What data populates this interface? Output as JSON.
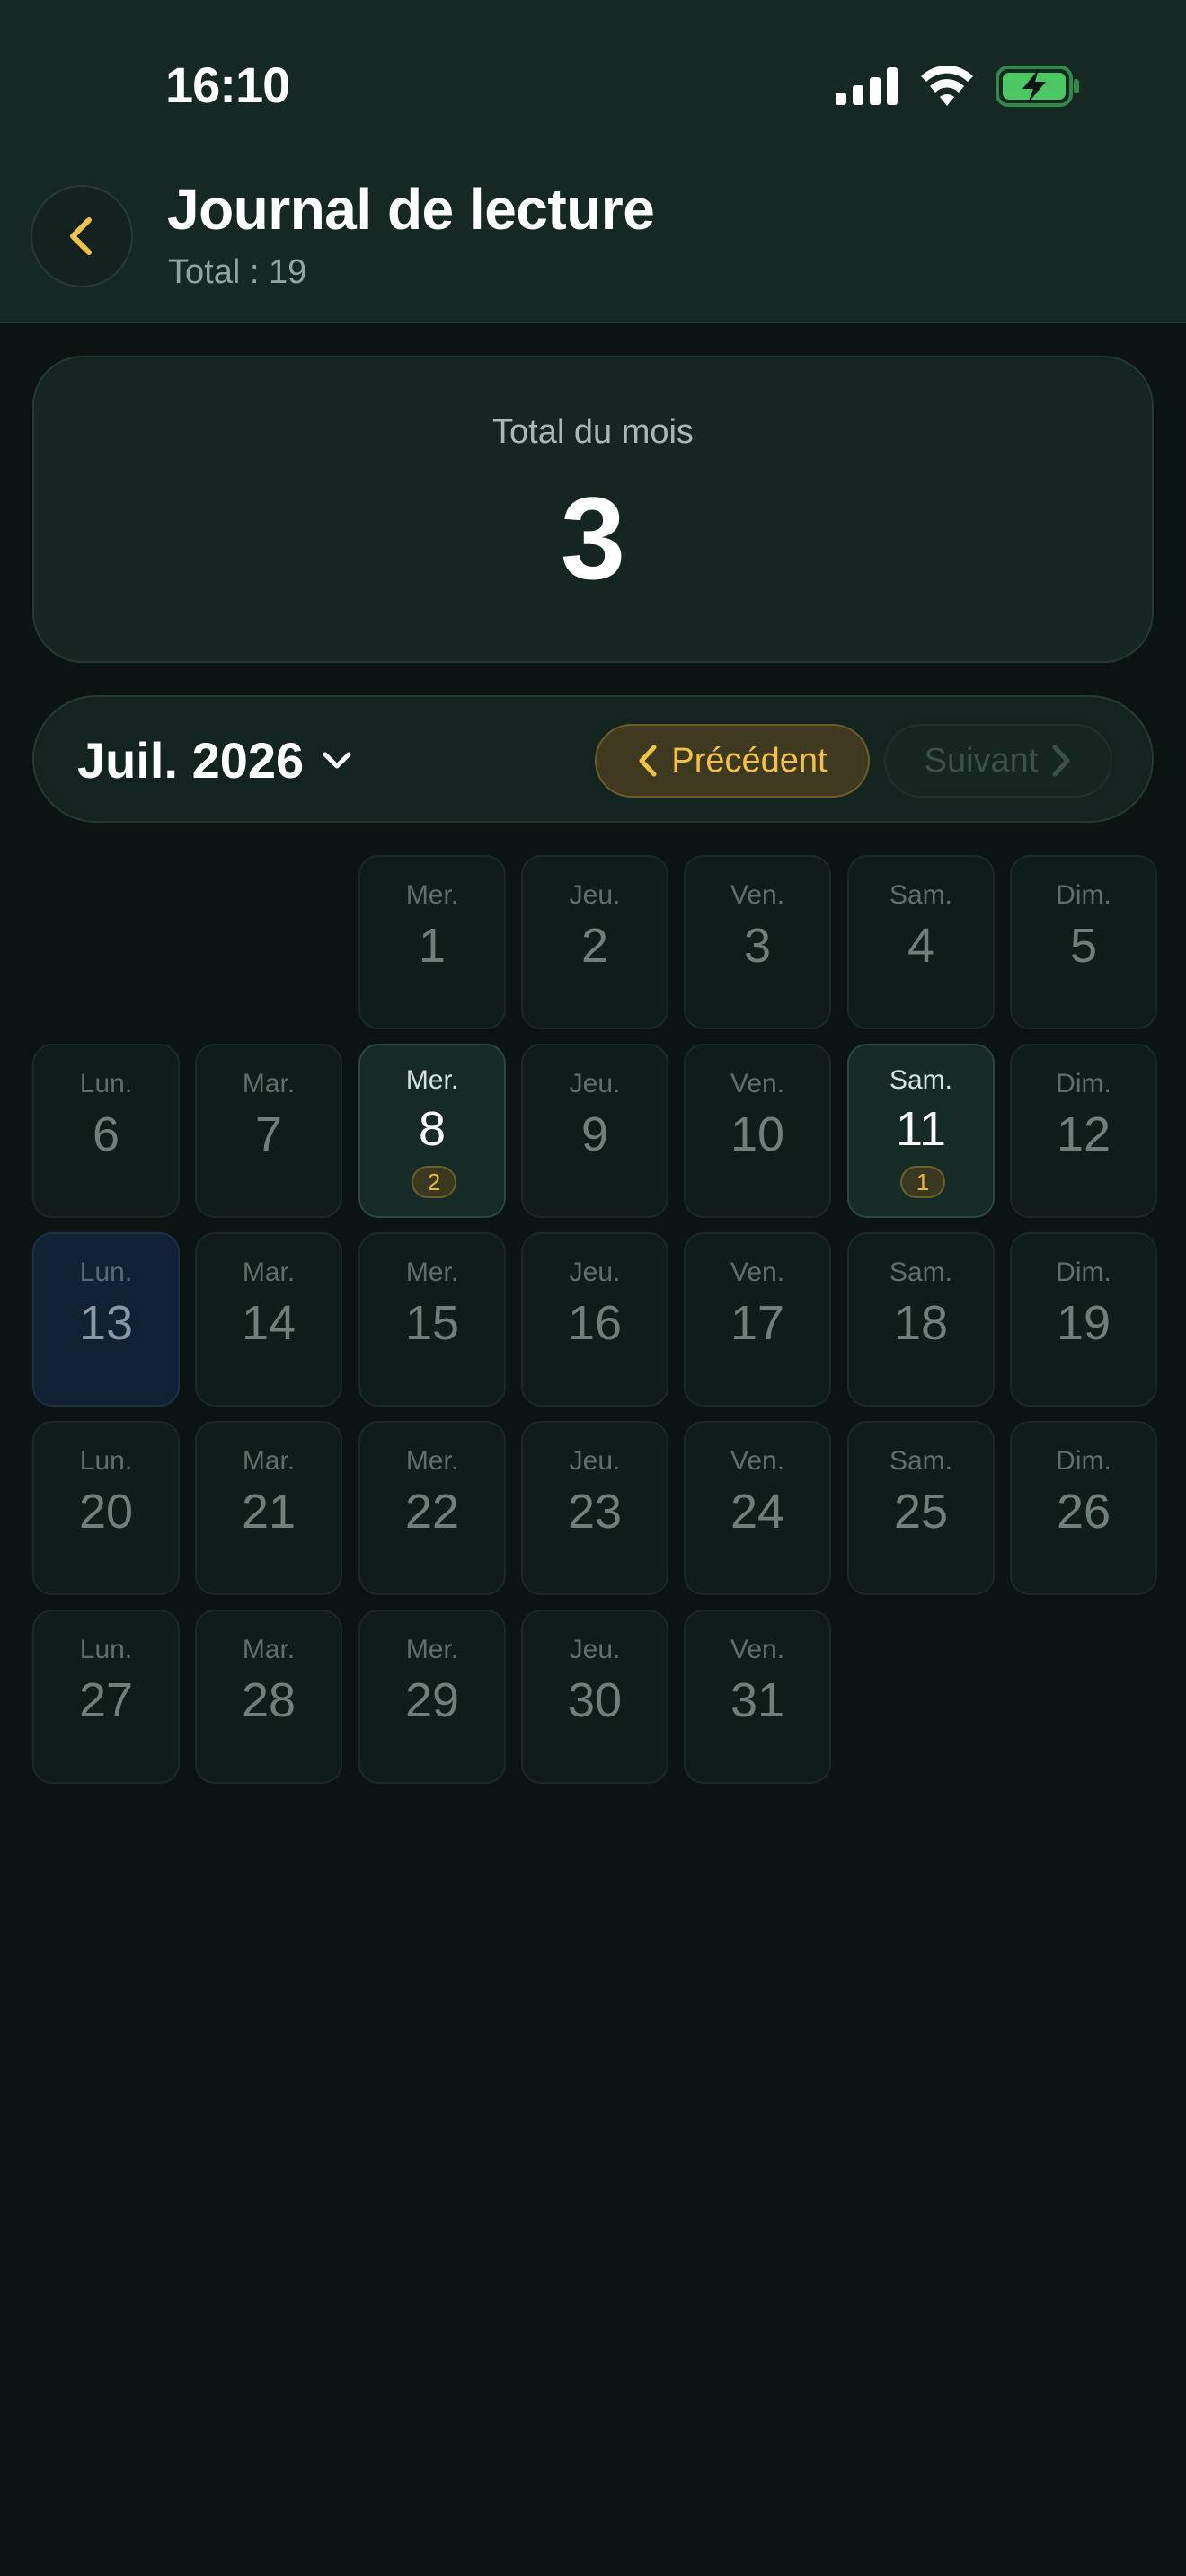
{
  "status_bar": {
    "time": "16:10"
  },
  "header": {
    "title": "Journal de lecture",
    "subtitle": "Total : 19"
  },
  "summary": {
    "label": "Total du mois",
    "value": "3"
  },
  "month_nav": {
    "month_label": "Juil. 2026",
    "prev_label": "Précédent",
    "next_label": "Suivant"
  },
  "calendar": {
    "days": [
      {
        "dow": "Mer.",
        "num": "1"
      },
      {
        "dow": "Jeu.",
        "num": "2"
      },
      {
        "dow": "Ven.",
        "num": "3"
      },
      {
        "dow": "Sam.",
        "num": "4"
      },
      {
        "dow": "Dim.",
        "num": "5"
      },
      {
        "dow": "Lun.",
        "num": "6"
      },
      {
        "dow": "Mar.",
        "num": "7"
      },
      {
        "dow": "Mer.",
        "num": "8",
        "count": "2"
      },
      {
        "dow": "Jeu.",
        "num": "9"
      },
      {
        "dow": "Ven.",
        "num": "10"
      },
      {
        "dow": "Sam.",
        "num": "11",
        "count": "1"
      },
      {
        "dow": "Dim.",
        "num": "12"
      },
      {
        "dow": "Lun.",
        "num": "13"
      },
      {
        "dow": "Mar.",
        "num": "14"
      },
      {
        "dow": "Mer.",
        "num": "15"
      },
      {
        "dow": "Jeu.",
        "num": "16"
      },
      {
        "dow": "Ven.",
        "num": "17"
      },
      {
        "dow": "Sam.",
        "num": "18"
      },
      {
        "dow": "Dim.",
        "num": "19"
      },
      {
        "dow": "Lun.",
        "num": "20"
      },
      {
        "dow": "Mar.",
        "num": "21"
      },
      {
        "dow": "Mer.",
        "num": "22"
      },
      {
        "dow": "Jeu.",
        "num": "23"
      },
      {
        "dow": "Ven.",
        "num": "24"
      },
      {
        "dow": "Sam.",
        "num": "25"
      },
      {
        "dow": "Dim.",
        "num": "26"
      },
      {
        "dow": "Lun.",
        "num": "27"
      },
      {
        "dow": "Mar.",
        "num": "28"
      },
      {
        "dow": "Mer.",
        "num": "29"
      },
      {
        "dow": "Jeu.",
        "num": "30"
      },
      {
        "dow": "Ven.",
        "num": "31"
      }
    ]
  },
  "colors": {
    "accent": "#f2c14a",
    "background": "#0b1412",
    "header": "#162824",
    "battery": "#4cc764"
  }
}
